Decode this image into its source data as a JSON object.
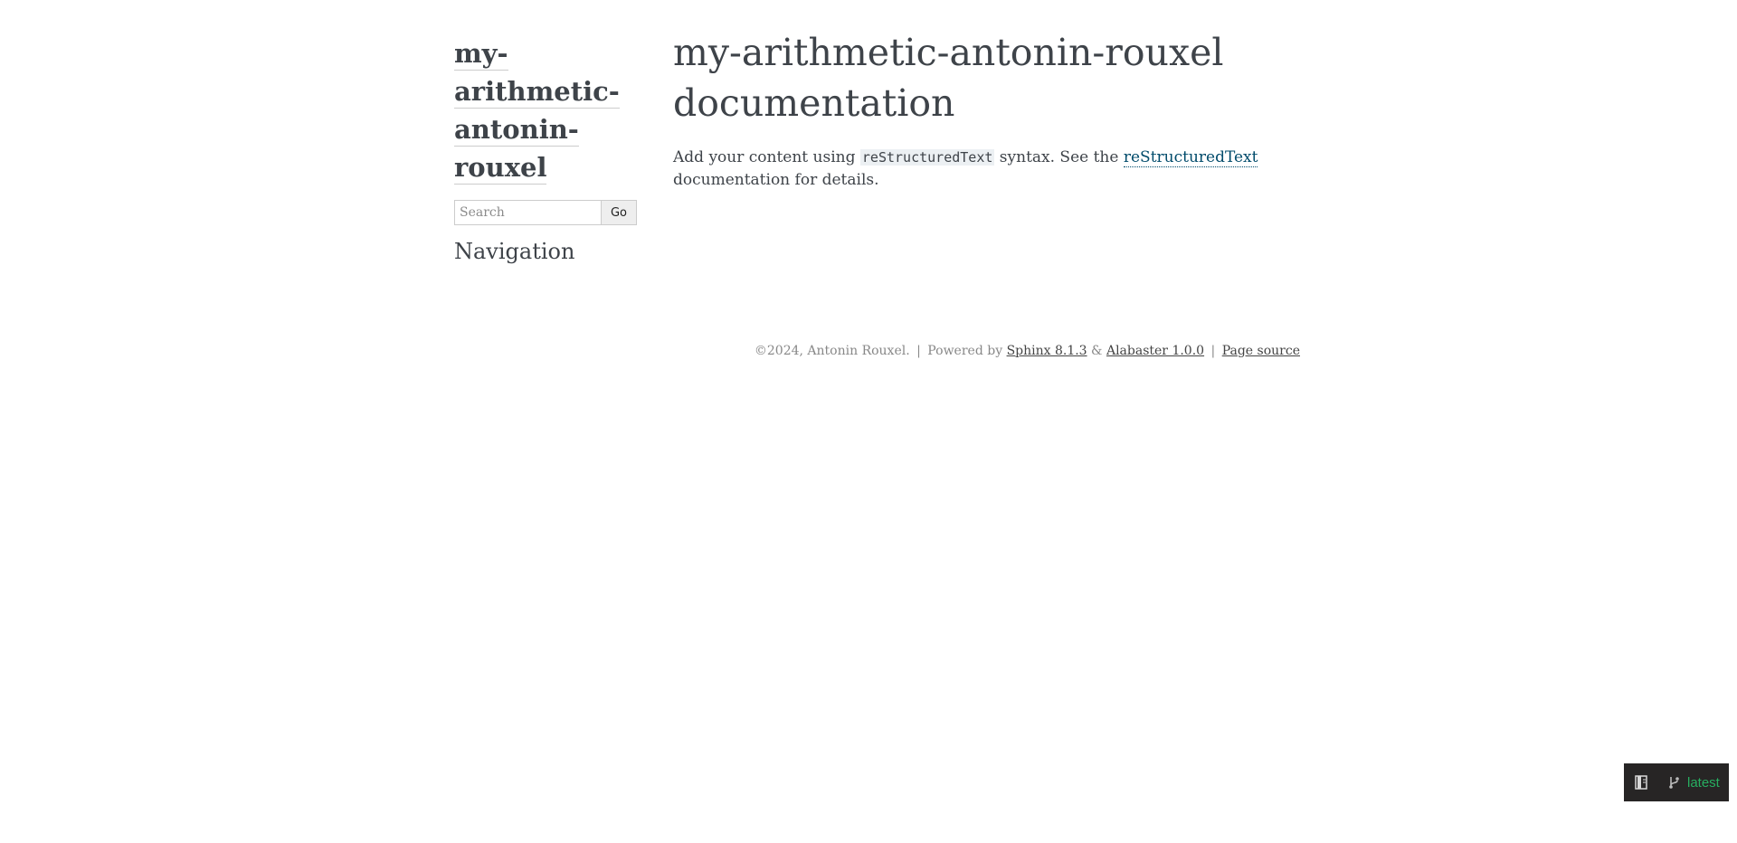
{
  "sidebar": {
    "logo_parts": [
      "my-",
      "arithmetic-",
      "antonin-",
      "rouxel"
    ],
    "search": {
      "placeholder": "Search",
      "button_label": "Go"
    },
    "navigation_heading": "Navigation"
  },
  "main": {
    "title_line1": "my-arithmetic-antonin-rouxel",
    "title_line2": "documentation",
    "intro": {
      "text_before": "Add your content using ",
      "code": "reStructuredText",
      "text_middle": " syntax. See the ",
      "link": "reStructuredText",
      "text_after": " documentation for details."
    }
  },
  "footer": {
    "copyright": "©2024, Antonin Rouxel.",
    "separator": "|",
    "powered_by": "Powered by",
    "sphinx_link": "Sphinx 8.1.3",
    "ampersand": "&",
    "alabaster_link": "Alabaster 1.0.0",
    "page_source_link": "Page source"
  },
  "flyout": {
    "version_label": "latest",
    "book_icon": "book-icon",
    "branch_icon": "git-branch-icon"
  },
  "colors": {
    "text": "#3e4349",
    "link": "#004b6b",
    "code_background": "#ecf0f3",
    "flyout_background": "#272525",
    "version_green": "#27ae60"
  }
}
